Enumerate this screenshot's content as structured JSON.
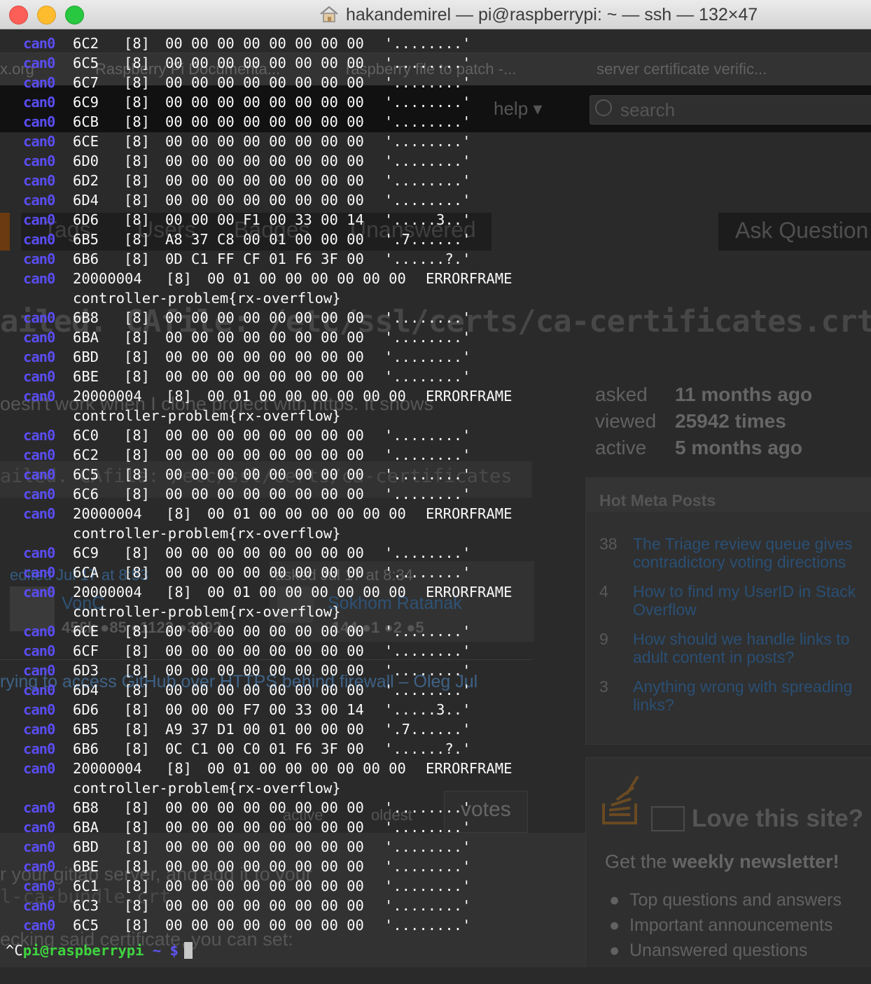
{
  "window": {
    "title": "hakandemirel — pi@raspberrypi: ~ — ssh — 132×47",
    "traffic_lights": {
      "close": "#fc5f57",
      "minimize": "#fdbc2e",
      "maximize": "#28c840"
    }
  },
  "colors": {
    "background": "#2a2a2a",
    "text": "#fafafa",
    "iface": "#5a4df0",
    "prompt_user": "#3fd43f"
  },
  "background_page": {
    "tabs": [
      "x.org",
      "Raspberry Pi Documenta...",
      "raspberry file to patch -...",
      "server certificate verific..."
    ],
    "help": "help ▾",
    "search_placeholder": "search",
    "nav_tabs": [
      "Tags",
      "Users",
      "Badges",
      "Unanswered"
    ],
    "ask_button": "Ask Question",
    "question_title": "ailed. CAfile: /etc/ssl/certs/ca-certificates.crt CRLfile: non",
    "question_text": "oesn't work when I clone project with https. It shows",
    "code_line": "ailed. CAfile: /etc/ssl/certs/ca-certificates",
    "stats": [
      {
        "label": "asked",
        "value": "11 months ago"
      },
      {
        "label": "viewed",
        "value": "25942 times"
      },
      {
        "label": "active",
        "value": "5 months ago"
      }
    ],
    "hot_meta": {
      "title": "Hot Meta Posts",
      "items": [
        {
          "num": "38",
          "text": "The Triage review queue gives contradictory voting directions"
        },
        {
          "num": "4",
          "text": "How to find my UserID in Stack Overflow"
        },
        {
          "num": "9",
          "text": "How should we handle links to adult content in posts?"
        },
        {
          "num": "3",
          "text": "Anything wrong with spreading links?"
        }
      ]
    },
    "edited": "edited Jul 17 at 8:53",
    "asked": "asked Jul 17 at 8:34",
    "editor": {
      "name": "VonC",
      "rep": "45£k  ●85 ●1122 ●3992"
    },
    "asker": {
      "name": "Sokhom Ratanak",
      "rep": "144  ●1 ●2 ●5"
    },
    "comment": "rying to access GitHub over HTTPS behind firewall –  Oleg Jul",
    "sort": [
      "active",
      "oldest",
      "votes"
    ],
    "answer_lines": [
      "r your gitlab server, and add it to your",
      "l-ca-bundle.crt",
      "ecking said certificate, you can set:"
    ],
    "newsletter": {
      "title": "Love this site?",
      "subtitle_pre": "Get the ",
      "subtitle_bold": "weekly newsletter!",
      "bullets": [
        "Top questions and answers",
        "Important announcements",
        "Unanswered questions"
      ]
    }
  },
  "terminal": {
    "lines": [
      {
        "iface": "can0",
        "id": "6C2",
        "dlc": "[8]",
        "data": "00 00 00 00 00 00 00 00",
        "ascii": "'........'"
      },
      {
        "iface": "can0",
        "id": "6C5",
        "dlc": "[8]",
        "data": "00 00 00 00 00 00 00 00",
        "ascii": "'........'"
      },
      {
        "iface": "can0",
        "id": "6C7",
        "dlc": "[8]",
        "data": "00 00 00 00 00 00 00 00",
        "ascii": "'........'"
      },
      {
        "iface": "can0",
        "id": "6C9",
        "dlc": "[8]",
        "data": "00 00 00 00 00 00 00 00",
        "ascii": "'........'"
      },
      {
        "iface": "can0",
        "id": "6CB",
        "dlc": "[8]",
        "data": "00 00 00 00 00 00 00 00",
        "ascii": "'........'"
      },
      {
        "iface": "can0",
        "id": "6CE",
        "dlc": "[8]",
        "data": "00 00 00 00 00 00 00 00",
        "ascii": "'........'"
      },
      {
        "iface": "can0",
        "id": "6D0",
        "dlc": "[8]",
        "data": "00 00 00 00 00 00 00 00",
        "ascii": "'........'"
      },
      {
        "iface": "can0",
        "id": "6D2",
        "dlc": "[8]",
        "data": "00 00 00 00 00 00 00 00",
        "ascii": "'........'"
      },
      {
        "iface": "can0",
        "id": "6D4",
        "dlc": "[8]",
        "data": "00 00 00 00 00 00 00 00",
        "ascii": "'........'"
      },
      {
        "iface": "can0",
        "id": "6D6",
        "dlc": "[8]",
        "data": "00 00 00 F1 00 33 00 14",
        "ascii": "'.....3..'"
      },
      {
        "iface": "can0",
        "id": "6B5",
        "dlc": "[8]",
        "data": "A8 37 C8 00 01 00 00 00",
        "ascii": "'.7......'"
      },
      {
        "iface": "can0",
        "id": "6B6",
        "dlc": "[8]",
        "data": "0D C1 FF CF 01 F6 3F 00",
        "ascii": "'......?.'"
      },
      {
        "iface": "can0",
        "id": "20000004",
        "dlc": "[8]",
        "data": "00 01 00 00 00 00 00 00",
        "ascii": "ERRORFRAME",
        "err": true
      },
      {
        "wrap": "controller-problem{rx-overflow}"
      },
      {
        "iface": "can0",
        "id": "6B8",
        "dlc": "[8]",
        "data": "00 00 00 00 00 00 00 00",
        "ascii": "'........'"
      },
      {
        "iface": "can0",
        "id": "6BA",
        "dlc": "[8]",
        "data": "00 00 00 00 00 00 00 00",
        "ascii": "'........'"
      },
      {
        "iface": "can0",
        "id": "6BD",
        "dlc": "[8]",
        "data": "00 00 00 00 00 00 00 00",
        "ascii": "'........'"
      },
      {
        "iface": "can0",
        "id": "6BE",
        "dlc": "[8]",
        "data": "00 00 00 00 00 00 00 00",
        "ascii": "'........'"
      },
      {
        "iface": "can0",
        "id": "20000004",
        "dlc": "[8]",
        "data": "00 01 00 00 00 00 00 00",
        "ascii": "ERRORFRAME",
        "err": true
      },
      {
        "wrap": "controller-problem{rx-overflow}"
      },
      {
        "iface": "can0",
        "id": "6C0",
        "dlc": "[8]",
        "data": "00 00 00 00 00 00 00 00",
        "ascii": "'........'"
      },
      {
        "iface": "can0",
        "id": "6C2",
        "dlc": "[8]",
        "data": "00 00 00 00 00 00 00 00",
        "ascii": "'........'"
      },
      {
        "iface": "can0",
        "id": "6C5",
        "dlc": "[8]",
        "data": "00 00 00 00 00 00 00 00",
        "ascii": "'........'"
      },
      {
        "iface": "can0",
        "id": "6C6",
        "dlc": "[8]",
        "data": "00 00 00 00 00 00 00 00",
        "ascii": "'........'"
      },
      {
        "iface": "can0",
        "id": "20000004",
        "dlc": "[8]",
        "data": "00 01 00 00 00 00 00 00",
        "ascii": "ERRORFRAME",
        "err": true
      },
      {
        "wrap": "controller-problem{rx-overflow}"
      },
      {
        "iface": "can0",
        "id": "6C9",
        "dlc": "[8]",
        "data": "00 00 00 00 00 00 00 00",
        "ascii": "'........'"
      },
      {
        "iface": "can0",
        "id": "6CA",
        "dlc": "[8]",
        "data": "00 00 00 00 00 00 00 00",
        "ascii": "'........'"
      },
      {
        "iface": "can0",
        "id": "20000004",
        "dlc": "[8]",
        "data": "00 01 00 00 00 00 00 00",
        "ascii": "ERRORFRAME",
        "err": true
      },
      {
        "wrap": "controller-problem{rx-overflow}"
      },
      {
        "iface": "can0",
        "id": "6CE",
        "dlc": "[8]",
        "data": "00 00 00 00 00 00 00 00",
        "ascii": "'........'"
      },
      {
        "iface": "can0",
        "id": "6CF",
        "dlc": "[8]",
        "data": "00 00 00 00 00 00 00 00",
        "ascii": "'........'"
      },
      {
        "iface": "can0",
        "id": "6D3",
        "dlc": "[8]",
        "data": "00 00 00 00 00 00 00 00",
        "ascii": "'........'"
      },
      {
        "iface": "can0",
        "id": "6D4",
        "dlc": "[8]",
        "data": "00 00 00 00 00 00 00 00",
        "ascii": "'........'"
      },
      {
        "iface": "can0",
        "id": "6D6",
        "dlc": "[8]",
        "data": "00 00 00 F7 00 33 00 14",
        "ascii": "'.....3..'"
      },
      {
        "iface": "can0",
        "id": "6B5",
        "dlc": "[8]",
        "data": "A9 37 D1 00 01 00 00 00",
        "ascii": "'.7......'"
      },
      {
        "iface": "can0",
        "id": "6B6",
        "dlc": "[8]",
        "data": "0C C1 00 C0 01 F6 3F 00",
        "ascii": "'......?.'"
      },
      {
        "iface": "can0",
        "id": "20000004",
        "dlc": "[8]",
        "data": "00 01 00 00 00 00 00 00",
        "ascii": "ERRORFRAME",
        "err": true
      },
      {
        "wrap": "controller-problem{rx-overflow}"
      },
      {
        "iface": "can0",
        "id": "6B8",
        "dlc": "[8]",
        "data": "00 00 00 00 00 00 00 00",
        "ascii": "'........'"
      },
      {
        "iface": "can0",
        "id": "6BA",
        "dlc": "[8]",
        "data": "00 00 00 00 00 00 00 00",
        "ascii": "'........'"
      },
      {
        "iface": "can0",
        "id": "6BD",
        "dlc": "[8]",
        "data": "00 00 00 00 00 00 00 00",
        "ascii": "'........'"
      },
      {
        "iface": "can0",
        "id": "6BE",
        "dlc": "[8]",
        "data": "00 00 00 00 00 00 00 00",
        "ascii": "'........'"
      },
      {
        "iface": "can0",
        "id": "6C1",
        "dlc": "[8]",
        "data": "00 00 00 00 00 00 00 00",
        "ascii": "'........'"
      },
      {
        "iface": "can0",
        "id": "6C3",
        "dlc": "[8]",
        "data": "00 00 00 00 00 00 00 00",
        "ascii": "'........'"
      },
      {
        "iface": "can0",
        "id": "6C5",
        "dlc": "[8]",
        "data": "00 00 00 00 00 00 00 00",
        "ascii": "'........'"
      }
    ],
    "prompt": {
      "ctrl": "^C",
      "user": "pi@raspberrypi",
      "path": "~",
      "symbol": "$"
    }
  }
}
